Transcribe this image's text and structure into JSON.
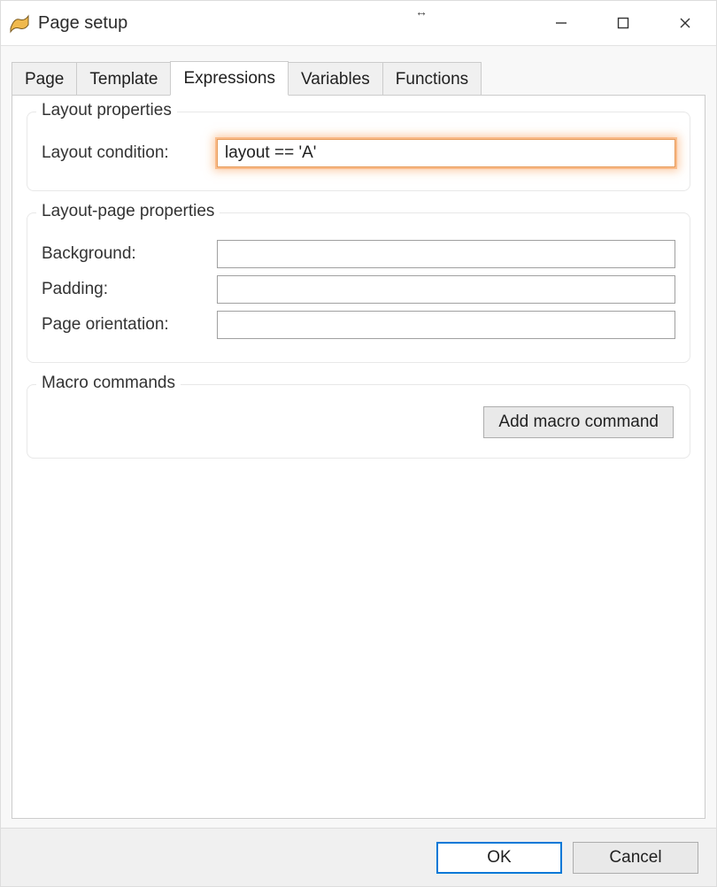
{
  "window": {
    "title": "Page setup"
  },
  "tabs": {
    "page": "Page",
    "template": "Template",
    "expressions": "Expressions",
    "variables": "Variables",
    "functions": "Functions"
  },
  "groups": {
    "layout_properties": {
      "legend": "Layout properties",
      "layout_condition_label": "Layout condition:",
      "layout_condition_value": "layout == 'A'"
    },
    "layout_page_properties": {
      "legend": "Layout-page properties",
      "background_label": "Background:",
      "background_value": "",
      "padding_label": "Padding:",
      "padding_value": "",
      "orientation_label": "Page orientation:",
      "orientation_value": ""
    },
    "macro_commands": {
      "legend": "Macro commands",
      "add_button": "Add macro command"
    }
  },
  "buttons": {
    "ok": "OK",
    "cancel": "Cancel"
  }
}
